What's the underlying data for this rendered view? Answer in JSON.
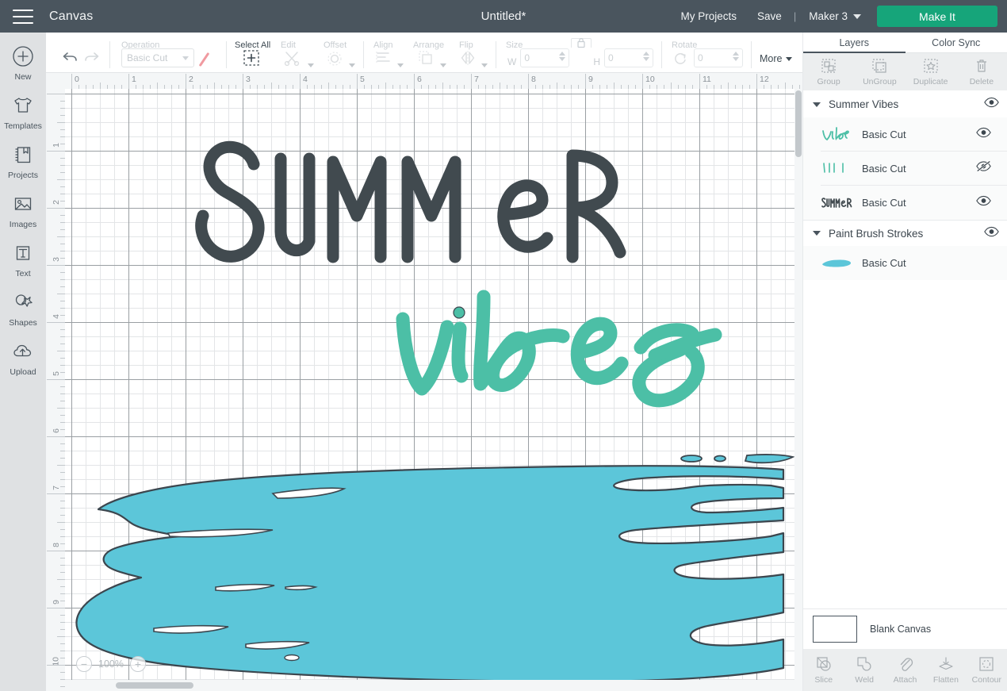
{
  "header": {
    "menu_icon": "hamburger-icon",
    "canvas_label": "Canvas",
    "document_title": "Untitled*",
    "my_projects": "My Projects",
    "save": "Save",
    "separator": "|",
    "machine": "Maker 3",
    "make_it": "Make It",
    "bar_color": "#4a555e",
    "make_it_color": "#16a57a"
  },
  "left_rail": {
    "items": [
      {
        "label": "New",
        "icon": "plus-circle-icon"
      },
      {
        "label": "Templates",
        "icon": "tshirt-icon"
      },
      {
        "label": "Projects",
        "icon": "book-bookmark-icon"
      },
      {
        "label": "Images",
        "icon": "picture-icon"
      },
      {
        "label": "Text",
        "icon": "text-t-icon"
      },
      {
        "label": "Shapes",
        "icon": "shapes-star-icon"
      },
      {
        "label": "Upload",
        "icon": "cloud-upload-icon"
      }
    ]
  },
  "toolbar": {
    "undo": "undo-arrow-icon",
    "redo": "redo-arrow-icon",
    "operation_caption": "Operation",
    "operation_value": "Basic Cut",
    "operation_color": "#f09aa0",
    "select_all_caption": "Select All",
    "select_all_icon": "dashed-square-plus-icon",
    "edit_caption": "Edit",
    "edit_icon": "scissors-icon",
    "offset_caption": "Offset",
    "offset_icon": "offset-sun-icon",
    "align_caption": "Align",
    "align_icon": "align-left-icon",
    "arrange_caption": "Arrange",
    "arrange_icon": "arrange-layers-icon",
    "flip_caption": "Flip",
    "flip_icon": "flip-horizontal-icon",
    "size_caption": "Size",
    "width_label": "W",
    "width_value": "0",
    "height_label": "H",
    "height_value": "0",
    "lock_icon": "lock-icon",
    "rotate_caption": "Rotate",
    "rotate_icon": "rotate-arrow-icon",
    "rotate_value": "0",
    "more_label": "More"
  },
  "canvas": {
    "zoom_out_icon": "minus-circle-icon",
    "zoom_level": "100%",
    "zoom_in_icon": "plus-circle-icon",
    "ruler_h_numbers": [
      "0",
      "1",
      "2",
      "3",
      "4",
      "5",
      "6",
      "7",
      "8",
      "9",
      "10",
      "11",
      "12"
    ],
    "ruler_v_numbers": [
      "1",
      "2",
      "3",
      "4",
      "5",
      "6",
      "7",
      "8",
      "9",
      "10"
    ],
    "artwork": {
      "word_summer": "SUMMER",
      "word_vibes": "vibes",
      "summer_color": "#414a4f",
      "vibes_color": "#4cbfa6",
      "brush_color": "#5cc6d9",
      "brush_outline": "#3c464e"
    }
  },
  "right_panel": {
    "tabs": [
      {
        "label": "Layers",
        "active": true
      },
      {
        "label": "Color Sync",
        "active": false
      }
    ],
    "layer_ops": [
      {
        "label": "Group",
        "icon": "group-icon"
      },
      {
        "label": "UnGroup",
        "icon": "ungroup-icon"
      },
      {
        "label": "Duplicate",
        "icon": "duplicate-icon"
      },
      {
        "label": "Delete",
        "icon": "trash-icon"
      }
    ],
    "groups": [
      {
        "name": "Summer Vibes",
        "visible": true,
        "eye_icon": "eye-icon",
        "layers": [
          {
            "name": "Basic Cut",
            "visible": true,
            "eye_icon": "eye-icon",
            "thumb": "vibes-script-thumb"
          },
          {
            "name": "Basic Cut",
            "visible": false,
            "eye_icon": "eye-slash-icon",
            "thumb": "tick-marks-thumb"
          },
          {
            "name": "Basic Cut",
            "visible": true,
            "eye_icon": "eye-icon",
            "thumb": "summer-word-thumb"
          }
        ]
      },
      {
        "name": "Paint Brush Strokes",
        "visible": true,
        "eye_icon": "eye-icon",
        "layers": [
          {
            "name": "Basic Cut",
            "visible": true,
            "eye_icon": "",
            "thumb": "brush-stroke-thumb"
          }
        ]
      }
    ],
    "blank_canvas_label": "Blank Canvas",
    "bottom_tools": [
      {
        "label": "Slice",
        "icon": "slice-icon"
      },
      {
        "label": "Weld",
        "icon": "weld-icon"
      },
      {
        "label": "Attach",
        "icon": "paperclip-icon"
      },
      {
        "label": "Flatten",
        "icon": "flatten-icon"
      },
      {
        "label": "Contour",
        "icon": "contour-icon"
      }
    ]
  }
}
